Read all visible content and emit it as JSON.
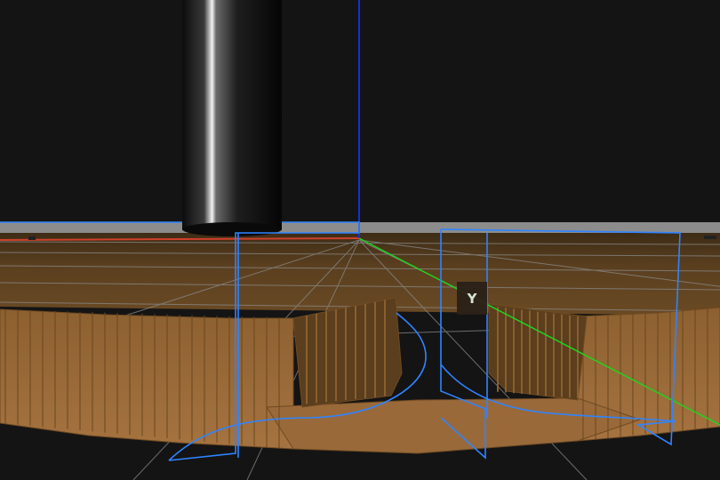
{
  "viewport": {
    "background_color": "#141414",
    "floor_color": "#5b3f1f",
    "grid_color": "#8a8a8a",
    "x_axis_color": "#d0402a",
    "y_axis_color": "#1fd41f",
    "z_axis_color": "#1530d8",
    "selection_color": "#2f84ff",
    "gear_color": "#9b6a3a",
    "cylinder_color": "#1a1a1a"
  },
  "axis_gizmo": {
    "label": "Y"
  }
}
